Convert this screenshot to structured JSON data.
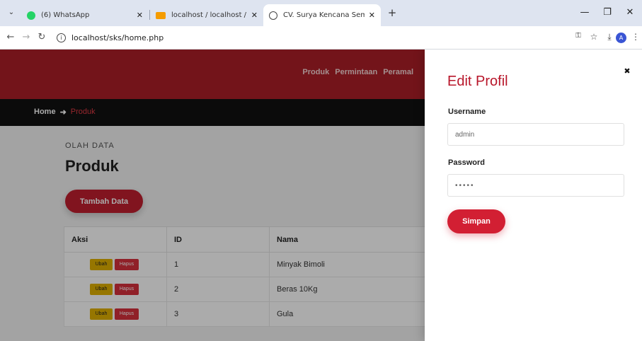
{
  "browser": {
    "tabs": [
      {
        "title": "(6) WhatsApp",
        "active": false
      },
      {
        "title": "localhost / localhost / sks / jual",
        "active": false
      },
      {
        "title": "CV. Surya Kencana Sembako",
        "active": true
      }
    ],
    "url": "localhost/sks/home.php",
    "profile_initial": "A"
  },
  "site": {
    "nav": [
      "Produk",
      "Permintaan",
      "Peramal"
    ],
    "breadcrumb": {
      "home": "Home",
      "current": "Produk"
    },
    "section_subtitle": "OLAH DATA",
    "section_title": "Produk",
    "add_button": "Tambah Data",
    "table": {
      "headers": [
        "Aksi",
        "ID",
        "Nama"
      ],
      "rows": [
        {
          "id": "1",
          "nama": "Minyak Bimoli"
        },
        {
          "id": "2",
          "nama": "Beras 10Kg"
        },
        {
          "id": "3",
          "nama": "Gula"
        }
      ],
      "edit_label": "Ubah",
      "delete_label": "Hapus"
    }
  },
  "panel": {
    "title": "Edit Profil",
    "username_label": "Username",
    "username_value": "admin",
    "password_label": "Password",
    "password_value": "•••••",
    "save_label": "Simpan",
    "close_glyph": "✖"
  },
  "colors": {
    "brand_red": "#ac1f28",
    "accent_red": "#d21f33",
    "edit_yellow": "#e0b000"
  }
}
